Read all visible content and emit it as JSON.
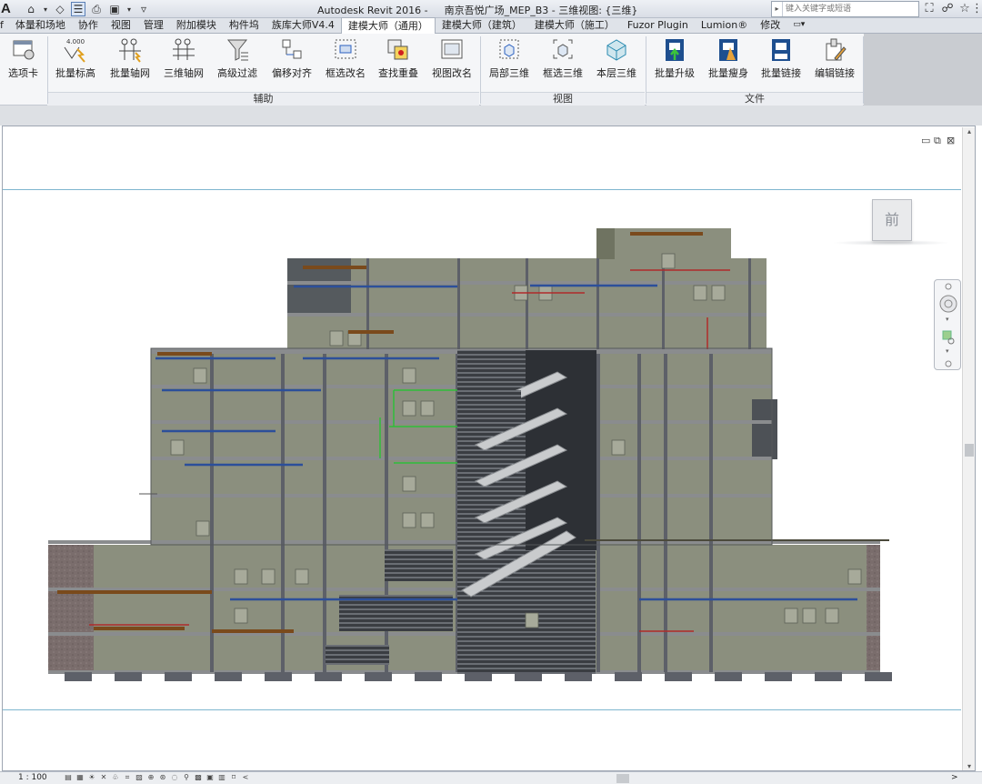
{
  "titlebar": {
    "logo": "A",
    "app_name": "Autodesk Revit 2016 -",
    "document": "南京吾悦广场_MEP_B3 - 三维视图: {三维}",
    "search_placeholder": "键入关键字或短语",
    "qat_icons": [
      "home-icon",
      "open-icon",
      "switch-windows-icon",
      "print-icon",
      "window-layout-icon",
      "customize-icon"
    ]
  },
  "tabs": [
    "体量和场地",
    "协作",
    "视图",
    "管理",
    "附加模块",
    "构件坞",
    "族库大师V4.4",
    "建模大师（通用）",
    "建模大师（建筑）",
    "建模大师（施工）",
    "Fuzor Plugin",
    "Lumion®",
    "修改"
  ],
  "active_tab": "建模大师（通用）",
  "ribbon": {
    "buttons": [
      {
        "label": "选项卡",
        "icon": "options-icon"
      },
      {
        "label": "批量标高",
        "icon": "batch-level-icon",
        "badge": "4.000"
      },
      {
        "label": "批量轴网",
        "icon": "batch-grid-icon"
      },
      {
        "label": "三维轴网",
        "icon": "3d-grid-icon"
      },
      {
        "label": "高级过滤",
        "icon": "filter-icon"
      },
      {
        "label": "偏移对齐",
        "icon": "offset-align-icon"
      },
      {
        "label": "框选改名",
        "icon": "box-rename-icon"
      },
      {
        "label": "查找重叠",
        "icon": "find-overlap-icon"
      },
      {
        "label": "视图改名",
        "icon": "view-rename-icon"
      },
      {
        "label": "局部三维",
        "icon": "local-3d-icon"
      },
      {
        "label": "框选三维",
        "icon": "box-3d-icon"
      },
      {
        "label": "本层三维",
        "icon": "level-3d-icon"
      },
      {
        "label": "批量升级",
        "icon": "batch-upgrade-icon"
      },
      {
        "label": "批量瘦身",
        "icon": "batch-purge-icon"
      },
      {
        "label": "批量链接",
        "icon": "batch-link-icon"
      },
      {
        "label": "编辑链接",
        "icon": "edit-link-icon"
      }
    ],
    "panels": [
      "辅助",
      "视图",
      "文件"
    ]
  },
  "viewport": {
    "viewcube_face": "前",
    "window_controls": [
      "minimize-icon",
      "restore-icon",
      "close-icon"
    ]
  },
  "statusbar": {
    "scale": "1 : 100",
    "scroll_left": "<",
    "scroll_right": ">"
  },
  "colors": {
    "slab": "#8a8c8e",
    "wall": "#8b8f7e",
    "frame": "#5d6068",
    "masonry": "#7a6d6c",
    "pipe_blue": "#2c4f9a",
    "pipe_green": "#2fbd3a",
    "pipe_red": "#b02a2a"
  }
}
